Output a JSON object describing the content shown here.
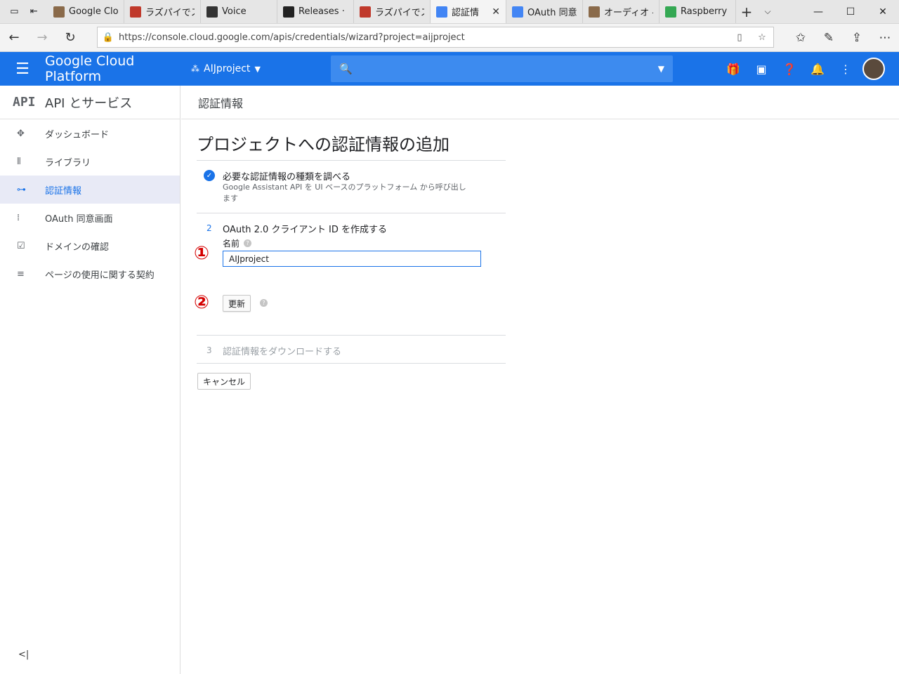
{
  "browser": {
    "tabs": [
      {
        "label": "Google Clo",
        "icon": "photo-favicon-icon",
        "color": "#8a6a4a"
      },
      {
        "label": "ラズパイでス",
        "icon": "plus-favicon-icon",
        "color": "#c0392b"
      },
      {
        "label": "Voice",
        "icon": "aiy-favicon-icon",
        "color": "#333333"
      },
      {
        "label": "Releases · g",
        "icon": "github-favicon-icon",
        "color": "#222222"
      },
      {
        "label": "ラズパイでス",
        "icon": "plus-favicon-icon",
        "color": "#c0392b"
      },
      {
        "label": "認証情",
        "icon": "gcp-favicon-icon",
        "color": "#4285f4",
        "active": true
      },
      {
        "label": "OAuth 同意",
        "icon": "gcp-favicon-icon",
        "color": "#4285f4"
      },
      {
        "label": "オーディオ - F",
        "icon": "photo-favicon-icon",
        "color": "#8a6a4a"
      },
      {
        "label": "Raspberry I",
        "icon": "raspberry-favicon-icon",
        "color": "#34a853"
      }
    ],
    "url": "https://console.cloud.google.com/apis/credentials/wizard?project=aijproject"
  },
  "header": {
    "brand": "Google Cloud Platform",
    "project": "AIJproject",
    "accent": "#1a73e8"
  },
  "sidebar": {
    "api_badge": "API",
    "title": "API とサービス",
    "items": [
      {
        "label": "ダッシュボード",
        "icon": "dashboard-icon"
      },
      {
        "label": "ライブラリ",
        "icon": "library-icon"
      },
      {
        "label": "認証情報",
        "icon": "key-icon",
        "active": true
      },
      {
        "label": "OAuth 同意画面",
        "icon": "consent-icon"
      },
      {
        "label": "ドメインの確認",
        "icon": "domain-check-icon"
      },
      {
        "label": "ページの使用に関する契約",
        "icon": "page-settings-icon"
      }
    ]
  },
  "main": {
    "breadcrumb": "認証情報",
    "page_title": "プロジェクトへの認証情報の追加",
    "step1": {
      "title": "必要な認証情報の種類を調べる",
      "desc": "Google Assistant API を UI ベースのプラットフォーム から呼び出します"
    },
    "step2": {
      "num": "2",
      "title": "OAuth 2.0 クライアント ID を作成する",
      "name_label": "名前",
      "name_value": "AIJproject",
      "update_label": "更新",
      "annotation1": "①",
      "annotation2": "②"
    },
    "step3": {
      "num": "3",
      "title": "認証情報をダウンロードする"
    },
    "cancel_label": "キャンセル"
  }
}
